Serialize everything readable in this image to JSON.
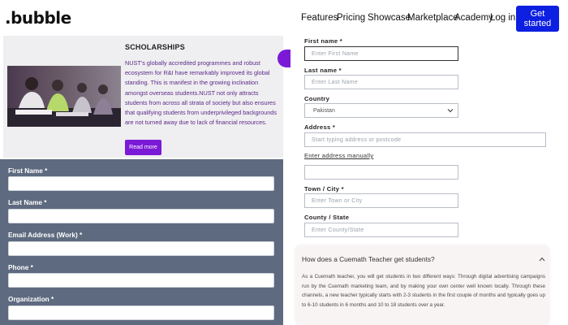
{
  "nav": {
    "logo": ".bubble",
    "items": [
      "Features",
      "Pricing",
      "Showcase",
      "Marketplace",
      "Academy",
      "Log in"
    ],
    "cta": "Get started"
  },
  "scholarship": {
    "title": "SCHOLARSHIPS",
    "body": "NUST's globally accredited programmes and robust ecosystem for R&I have remarkably improved its global standing. This is manifest in the growing inclination amongst overseas students.NUST not only attracts students from across all strata of society but also ensures that qualifying students from underprivileged backgrounds are not turned away due to lack of financial resources.",
    "read_more": "Read more"
  },
  "left_form": {
    "fields": [
      {
        "label": "First Name *",
        "value": ""
      },
      {
        "label": "Last Name *",
        "value": ""
      },
      {
        "label": "Email Address (Work) *",
        "value": ""
      },
      {
        "label": "Phone *",
        "value": ""
      },
      {
        "label": "Organization *",
        "value": ""
      }
    ]
  },
  "right_form": {
    "first_name": {
      "label": "First name *",
      "placeholder": "Enter First Name"
    },
    "last_name": {
      "label": "Last name *",
      "placeholder": "Enter Last Name"
    },
    "country": {
      "label": "Country",
      "value": "Pakistan"
    },
    "address": {
      "label": "Address *",
      "placeholder": "Start typing address or postcode"
    },
    "manual_link": "Enter address manually",
    "town": {
      "label": "Town / City *",
      "placeholder": "Enter Town or City"
    },
    "county": {
      "label": "County / State",
      "placeholder": "Enter County/State"
    }
  },
  "faq": {
    "question": "How does a Cuemath Teacher get students?",
    "answer": "As a Cuemath teacher, you will get students in two different ways: Through digital advertising campaigns run by the Cuemath marketing team, and by making your own center well known locally. Through these channels, a new teacher typically starts with 2-3 students in the first couple of months and typically goes up to 6-10 students in 6 months and 10 to 18 students over a year."
  },
  "colors": {
    "brand_blue": "#0d1fe0",
    "accent_purple": "#7a1ad6",
    "form_panel": "#5e6a7f"
  }
}
